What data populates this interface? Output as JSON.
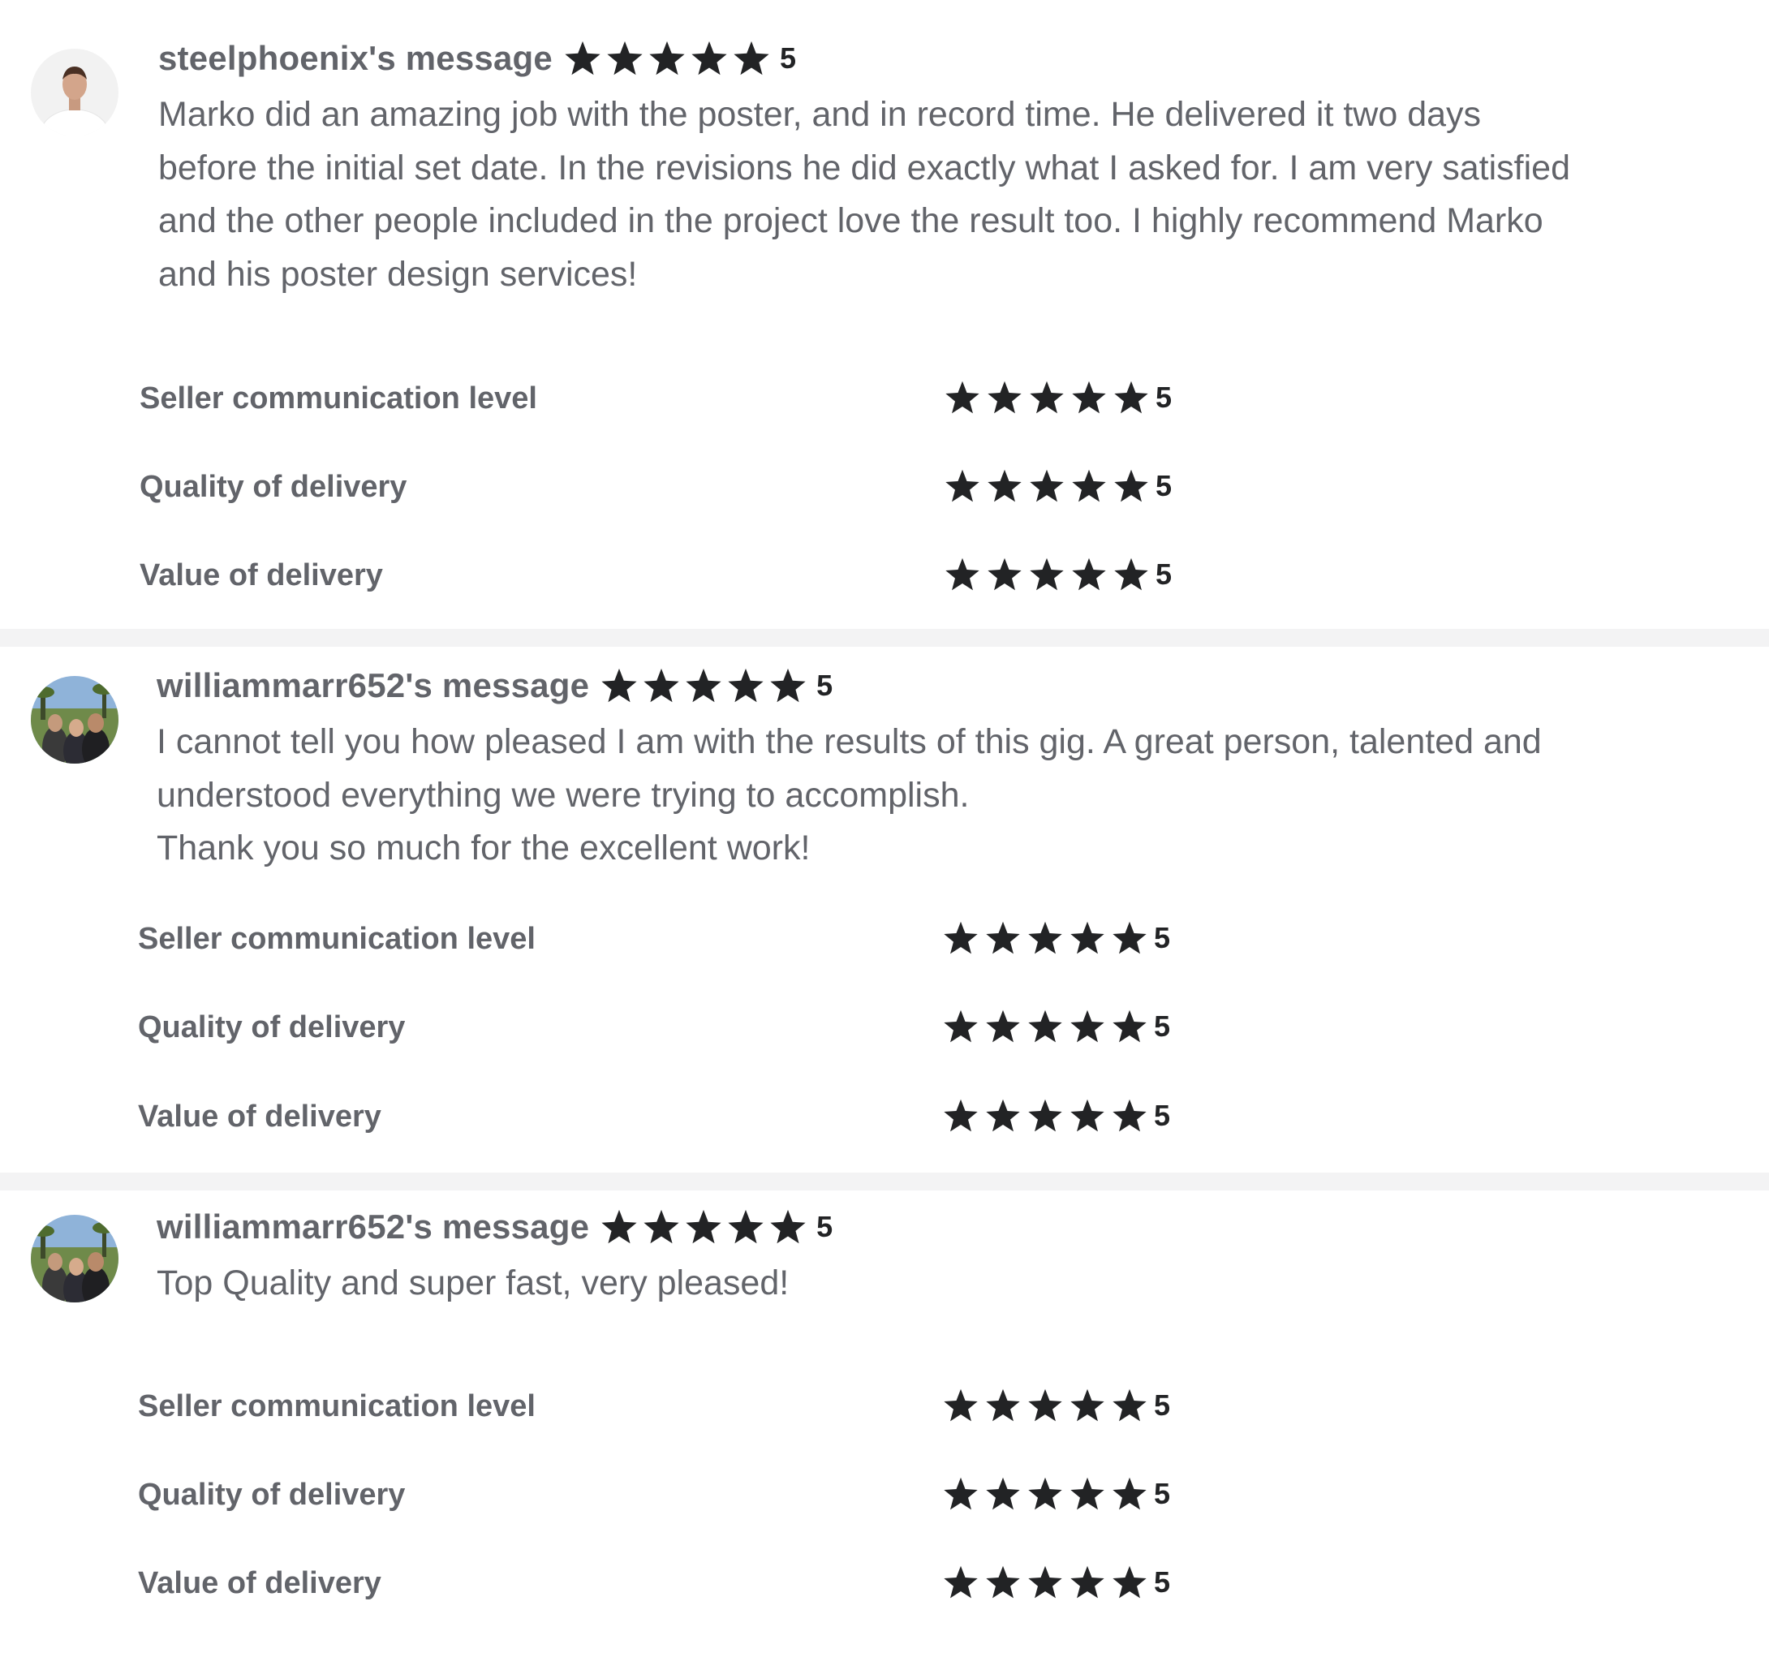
{
  "star_icon": "star-icon",
  "colors": {
    "text": "#62646a",
    "star": "#222325",
    "separator": "#f3f3f4"
  },
  "reviews": [
    {
      "username": "steelphoenix's message",
      "rating": 5,
      "rating_text": "5",
      "body_lines": [
        "Marko did an amazing job with the poster, and in record time. He delivered it two days",
        "before the initial set date. In the revisions he did exactly what I asked for. I am very satisfied",
        "and the other people included in the project love the result too. I highly recommend Marko",
        "and his poster design services!"
      ],
      "ratings": [
        {
          "label": "Seller communication level",
          "value": 5,
          "value_text": "5"
        },
        {
          "label": "Quality of delivery",
          "value": 5,
          "value_text": "5"
        },
        {
          "label": "Value of delivery",
          "value": 5,
          "value_text": "5"
        }
      ]
    },
    {
      "username": "williammarr652's message",
      "rating": 5,
      "rating_text": "5",
      "body_lines": [
        "I cannot tell you how pleased I am with the results of this gig. A great person, talented and",
        "understood everything we were trying to accomplish.",
        "Thank you so much for the excellent work!"
      ],
      "ratings": [
        {
          "label": "Seller communication level",
          "value": 5,
          "value_text": "5"
        },
        {
          "label": "Quality of delivery",
          "value": 5,
          "value_text": "5"
        },
        {
          "label": "Value of delivery",
          "value": 5,
          "value_text": "5"
        }
      ]
    },
    {
      "username": "williammarr652's message",
      "rating": 5,
      "rating_text": "5",
      "body_lines": [
        "Top Quality and super fast, very pleased!"
      ],
      "ratings": [
        {
          "label": "Seller communication level",
          "value": 5,
          "value_text": "5"
        },
        {
          "label": "Quality of delivery",
          "value": 5,
          "value_text": "5"
        },
        {
          "label": "Value of delivery",
          "value": 5,
          "value_text": "5"
        }
      ]
    }
  ]
}
